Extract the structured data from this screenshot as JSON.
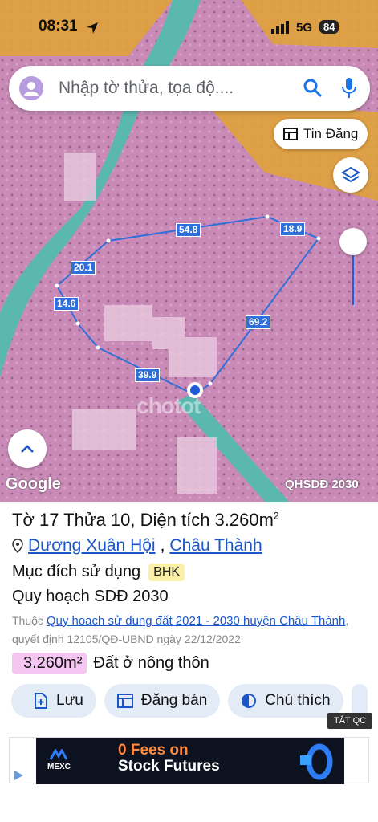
{
  "status_bar": {
    "time": "08:31",
    "network": "5G",
    "battery": "84"
  },
  "search": {
    "placeholder": "Nhập tờ thửa, tọa độ...."
  },
  "map": {
    "tin_dang_label": "Tin Đăng",
    "edge_labels": [
      "54.8",
      "18.9",
      "20.1",
      "14.6",
      "69.2",
      "39.9"
    ],
    "google_label": "Google",
    "layer_label": "QHSDĐ 2030",
    "watermark": "chotot"
  },
  "parcel": {
    "title": "Tờ 17 Thửa 10, Diện tích 3.260m",
    "title_sup": "2",
    "commune": "Dương Xuân Hội",
    "district": "Châu Thành",
    "purpose_label": "Mục đích sử dụng",
    "purpose_code": "BHK",
    "plan_label": "Quy hoạch SDĐ 2030",
    "note_prefix": "Thuộc",
    "note_link": "Quy hoach sử dung đất 2021 - 2030 huyện Châu Thành",
    "note_suffix": ", quyết định 12105/QĐ-UBND ngày 22/12/2022",
    "area_value": "3.260m²",
    "area_type": "Đất ở nông thôn"
  },
  "actions": {
    "save": "Lưu",
    "post": "Đăng bán",
    "legend": "Chú thích"
  },
  "ad": {
    "close_label": "TẮT QC",
    "brand": "MEXC",
    "headline_1": "0 Fees on",
    "headline_2": "Stock Futures"
  },
  "colors": {
    "pink": "#c98ab8",
    "road": "#e0a23a",
    "canal": "#5bb8b0",
    "boundary": "#2f6fd9",
    "link": "#1a56c9"
  }
}
